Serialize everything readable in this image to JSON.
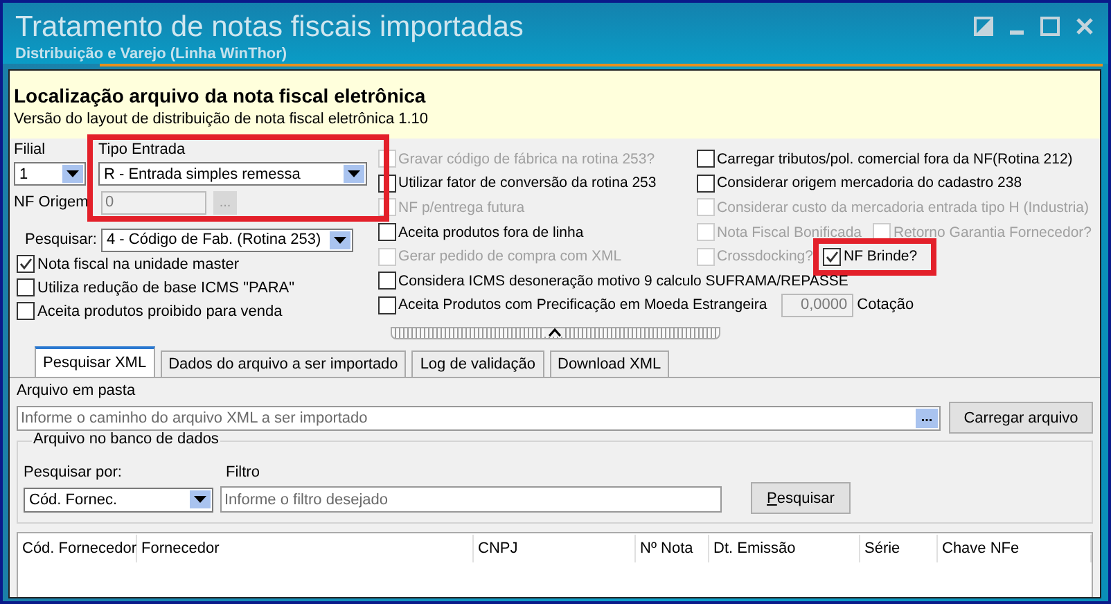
{
  "window": {
    "title": "Tratamento de notas fiscais importadas",
    "subtitle": "Distribuição e Varejo (Linha WinThor)"
  },
  "header": {
    "title": "Localização arquivo da nota fiscal eletrônica",
    "version": "Versão do layout de distribuição de nota fiscal eletrônica 1.10"
  },
  "filial": {
    "label": "Filial",
    "value": "1"
  },
  "tipo_entrada": {
    "label": "Tipo Entrada",
    "value": "R - Entrada simples remessa",
    "highlighted": true
  },
  "nf_origem": {
    "label": "NF Origem",
    "value": "0",
    "disabled": true,
    "button": "..."
  },
  "pesquisar": {
    "label": "Pesquisar:",
    "value": "4 - Código de Fab. (Rotina 253)"
  },
  "left_checks": [
    {
      "label": "Nota fiscal na unidade master",
      "checked": true,
      "disabled": false
    },
    {
      "label": "Utiliza redução de base ICMS \"PARA\"",
      "checked": false,
      "disabled": false
    },
    {
      "label": "Aceita produtos proibido para venda",
      "checked": false,
      "disabled": false
    }
  ],
  "option_rows": [
    {
      "options": [
        {
          "label": "Gravar código de fábrica na rotina 253?",
          "checked": false,
          "disabled": true,
          "highlighted": false
        },
        {
          "label": "Carregar tributos/pol. comercial fora da NF(Rotina 212)",
          "checked": false,
          "disabled": false,
          "highlighted": false
        }
      ]
    },
    {
      "options": [
        {
          "label": "Utilizar fator de conversão da rotina 253",
          "checked": false,
          "disabled": false,
          "highlighted": false
        },
        {
          "label": "Considerar origem mercadoria do cadastro 238",
          "checked": false,
          "disabled": false,
          "highlighted": false
        }
      ]
    },
    {
      "options": [
        {
          "label": "NF p/entrega futura",
          "checked": false,
          "disabled": true,
          "highlighted": false
        },
        {
          "label": "Considerar custo da mercadoria entrada tipo H (Industria)",
          "checked": false,
          "disabled": true,
          "highlighted": false
        }
      ]
    },
    {
      "options": [
        {
          "label": "Aceita produtos fora de linha",
          "checked": false,
          "disabled": false,
          "highlighted": false
        },
        {
          "label": "Nota Fiscal Bonificada",
          "checked": false,
          "disabled": true,
          "highlighted": false
        },
        {
          "label": "Retorno Garantia Fornecedor?",
          "checked": false,
          "disabled": true,
          "highlighted": false
        }
      ]
    },
    {
      "options": [
        {
          "label": "Gerar pedido de compra com XML",
          "checked": false,
          "disabled": true,
          "highlighted": false
        },
        {
          "label": "Crossdocking?",
          "checked": false,
          "disabled": true,
          "highlighted": false
        },
        {
          "label": "NF Brinde?",
          "checked": true,
          "disabled": false,
          "highlighted": true
        }
      ]
    },
    {
      "options": [
        {
          "label": "Considera ICMS desoneração motivo 9 calculo SUFRAMA/REPASSE",
          "checked": false,
          "disabled": false,
          "highlighted": false
        }
      ]
    },
    {
      "options": [
        {
          "label": "Aceita Produtos com Precificação em Moeda Estrangeira",
          "checked": false,
          "disabled": false,
          "highlighted": false
        }
      ],
      "cotacao": {
        "value": "0,0000",
        "label": "Cotação",
        "disabled": true
      }
    }
  ],
  "tabs": [
    {
      "label": "Pesquisar XML",
      "selected": true
    },
    {
      "label": "Dados do arquivo a ser importado",
      "selected": false
    },
    {
      "label": "Log de validação",
      "selected": false
    },
    {
      "label": "Download XML",
      "selected": false
    }
  ],
  "arquivo_em_pasta": {
    "label": "Arquivo em pasta",
    "placeholder": "Informe o caminho do arquivo XML a ser importado",
    "browse_button": "...",
    "load_button": "Carregar arquivo"
  },
  "banco": {
    "title": "Arquivo no banco de dados",
    "search_by": {
      "label": "Pesquisar por:",
      "value": "Cód. Fornec."
    },
    "filter": {
      "label": "Filtro",
      "placeholder": "Informe o filtro desejado"
    },
    "search_button": "Pesquisar"
  },
  "table": {
    "columns": [
      "Cód. Fornecedor",
      "Fornecedor",
      "CNPJ",
      "Nº Nota",
      "Dt. Emissão",
      "Série",
      "Chave NFe"
    ]
  }
}
